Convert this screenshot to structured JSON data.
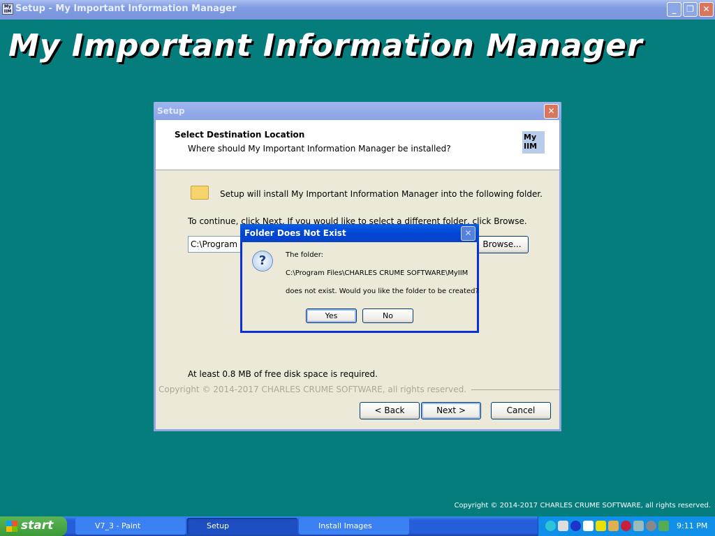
{
  "window": {
    "title": "Setup - My Important Information Manager",
    "icon_text": "My IIM"
  },
  "banner": {
    "title": "My Important Information Manager"
  },
  "setup": {
    "title": "Setup",
    "heading": "Select Destination Location",
    "subheading": "Where should My Important Information Manager be installed?",
    "logo": "My IIM",
    "info": "Setup will install My Important Information Manager into the following folder.",
    "continue_text": "To continue, click Next. If you would like to select a different folder, click Browse.",
    "path_value": "C:\\Program Files\\CHARLES CRUME SOFTWARE\\MyIIM",
    "browse": "Browse...",
    "disk_space": "At least 0.8 MB of free disk space is required.",
    "copyright": "Copyright © 2014-2017 CHARLES CRUME SOFTWARE, all rights reserved.",
    "back": "< Back",
    "next": "Next >",
    "cancel": "Cancel"
  },
  "dialog": {
    "title": "Folder Does Not Exist",
    "line1": "The folder:",
    "line2": "C:\\Program Files\\CHARLES CRUME SOFTWARE\\MyIIM",
    "line3": "does not exist. Would you like the folder to be created?",
    "yes": "Yes",
    "no": "No"
  },
  "desktop_copyright": "Copyright © 2014-2017 CHARLES CRUME SOFTWARE, all rights reserved.",
  "taskbar": {
    "start": "start",
    "tasks": [
      {
        "label": "V7_3 - Paint"
      },
      {
        "label": "Setup"
      },
      {
        "label": "Install Images"
      }
    ],
    "clock": "9:11 PM"
  }
}
